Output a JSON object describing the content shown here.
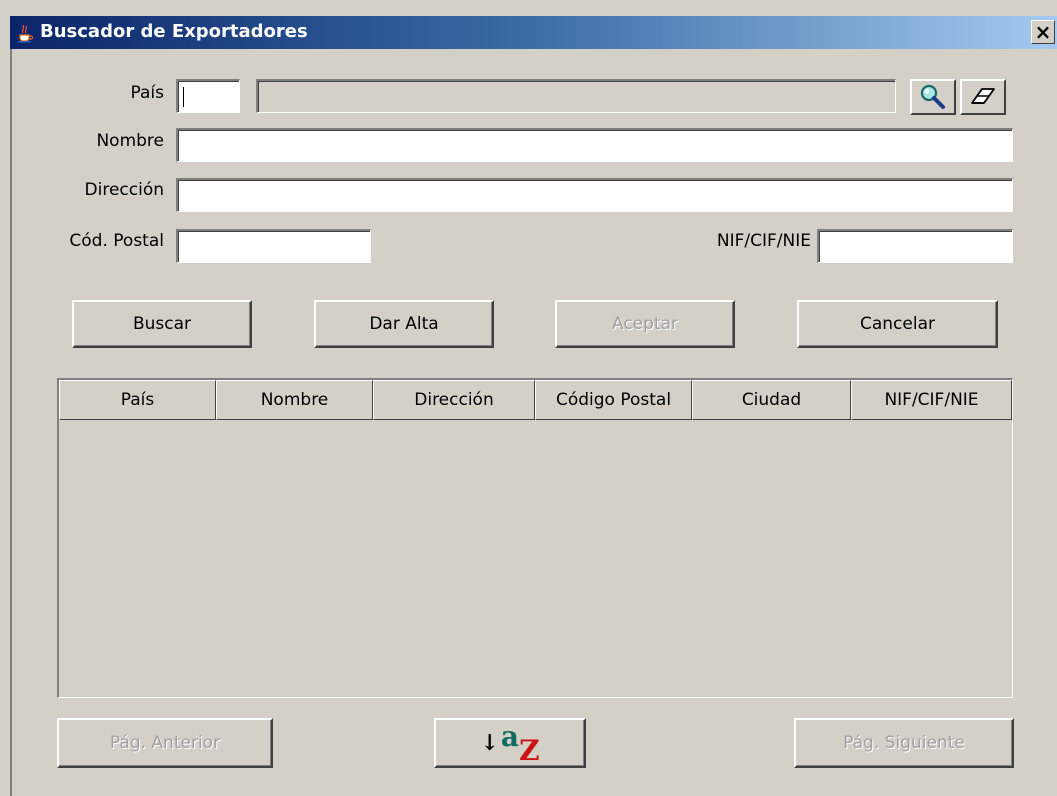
{
  "window": {
    "title": "Buscador de Exportadores",
    "close_glyph": "×",
    "title_icon": "java-cup-icon"
  },
  "form": {
    "pais_label": "País",
    "pais_code_value": "",
    "pais_name_value": "",
    "nombre_label": "Nombre",
    "nombre_value": "",
    "direccion_label": "Dirección",
    "direccion_value": "",
    "cp_label": "Cód. Postal",
    "cp_value": "",
    "nif_label": "NIF/CIF/NIE",
    "nif_value": "",
    "search_icon": "magnifier-icon",
    "clear_icon": "eraser-icon"
  },
  "actions": {
    "buscar": "Buscar",
    "dar_alta": "Dar Alta",
    "aceptar": "Aceptar",
    "cancelar": "Cancelar"
  },
  "table": {
    "columns": [
      "País",
      "Nombre",
      "Dirección",
      "Código Postal",
      "Ciudad",
      "NIF/CIF/NIE"
    ],
    "rows": []
  },
  "pagination": {
    "prev": "Pág. Anterior",
    "next": "Pág. Siguiente",
    "sort_icon": "sort-az-icon",
    "sort_a": "a",
    "sort_z": "z"
  },
  "colors": {
    "title_start": "#0a246a",
    "title_end": "#a6caf0",
    "face": "#d4d0c8",
    "sort_a": "#0f6b5e",
    "sort_z": "#cc1111"
  }
}
